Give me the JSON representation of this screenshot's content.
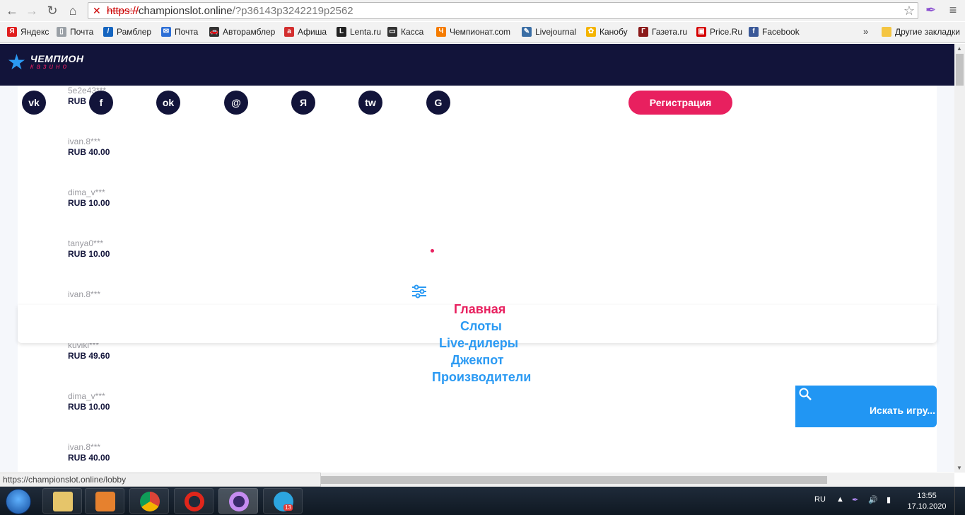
{
  "browser": {
    "url_scheme": "https://",
    "url_host": "championslot.online",
    "url_query": "/?p36143p3242219p2562",
    "bookmarks": [
      {
        "label": "Яндекс",
        "color": "#e01e1e",
        "glyph": "Я"
      },
      {
        "label": "Почта",
        "color": "#9aa0a6",
        "glyph": "▯"
      },
      {
        "label": "Рамблер",
        "color": "#1565c0",
        "glyph": "/"
      },
      {
        "label": "Почта",
        "color": "#2d6fd6",
        "glyph": "✉"
      },
      {
        "label": "Авторамблер",
        "color": "#333333",
        "glyph": "🚗"
      },
      {
        "label": "Афиша",
        "color": "#d32f2f",
        "glyph": "а"
      },
      {
        "label": "Lenta.ru",
        "color": "#222222",
        "glyph": "L"
      },
      {
        "label": "Касса",
        "color": "#333333",
        "glyph": "▭"
      },
      {
        "label": "Чемпионат.com",
        "color": "#f57c00",
        "glyph": "Ч"
      },
      {
        "label": "Livejournal",
        "color": "#3a6ea5",
        "glyph": "✎"
      },
      {
        "label": "Канобу",
        "color": "#f4b400",
        "glyph": "✿"
      },
      {
        "label": "Газета.ru",
        "color": "#8b1a1a",
        "glyph": "Г"
      },
      {
        "label": "Price.Ru",
        "color": "#d50000",
        "glyph": "▣"
      },
      {
        "label": "Facebook",
        "color": "#3b5998",
        "glyph": "f"
      }
    ],
    "more_label": "»",
    "other_bookmarks": "Другие закладки",
    "status_url": "https://championslot.online/lobby"
  },
  "site": {
    "logo_main": "ЧЕМПИОН",
    "logo_sub": "казино",
    "register_label": "Регистрация",
    "socials": [
      {
        "name": "vk",
        "glyph": "vk"
      },
      {
        "name": "facebook",
        "glyph": "f"
      },
      {
        "name": "odnoklassniki",
        "glyph": "ok"
      },
      {
        "name": "mail",
        "glyph": "@"
      },
      {
        "name": "yandex",
        "glyph": "Я"
      },
      {
        "name": "twitter",
        "glyph": "tw"
      },
      {
        "name": "google",
        "glyph": "G"
      }
    ],
    "winners": [
      {
        "user": "5e2e43***",
        "amount": "RUB"
      },
      {
        "user": "ivan.8***",
        "amount": "RUB 40.00"
      },
      {
        "user": "dima_v***",
        "amount": "RUB 10.00"
      },
      {
        "user": "tanya0***",
        "amount": "RUB 10.00"
      },
      {
        "user": "ivan.8***",
        "amount": ""
      },
      {
        "user": "kuvikl***",
        "amount": "RUB 49.60"
      },
      {
        "user": "dima_v***",
        "amount": "RUB 10.00"
      },
      {
        "user": "ivan.8***",
        "amount": "RUB 40.00"
      }
    ],
    "menu": [
      "Главная",
      "Слоты",
      "Live-дилеры",
      "Джекпот",
      "Производители"
    ],
    "search_label": "Искать игру..."
  },
  "taskbar": {
    "lang": "RU",
    "time": "13:55",
    "date": "17.10.2020",
    "telegram_badge": "13"
  },
  "colors": {
    "header_bg": "#12143a",
    "accent_pink": "#e8205f",
    "accent_blue": "#2b9af3"
  }
}
